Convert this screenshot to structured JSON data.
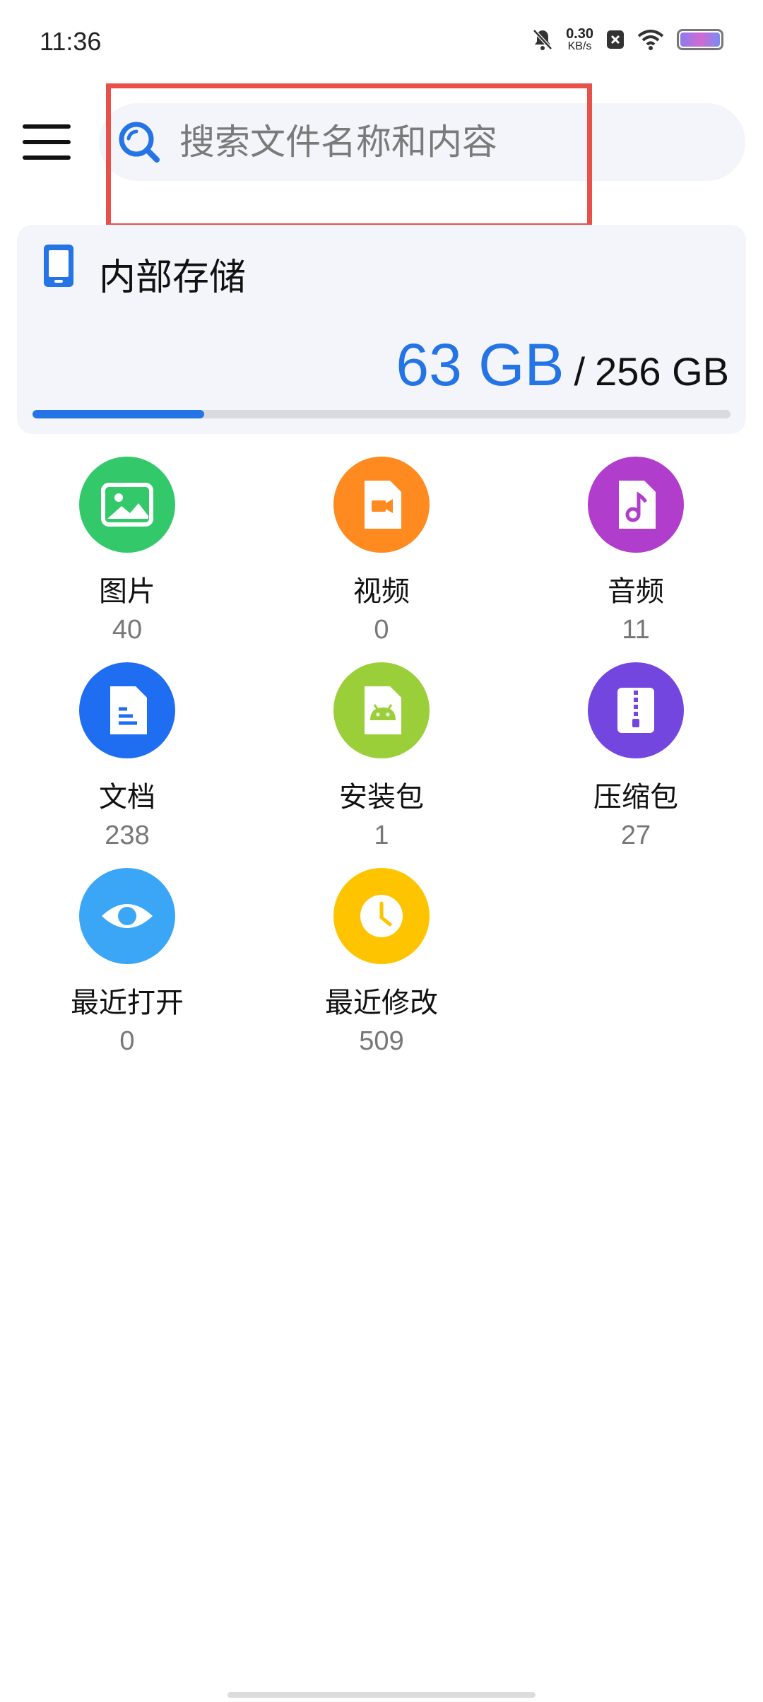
{
  "status_bar": {
    "time": "11:36",
    "net_speed_value": "0.30",
    "net_speed_unit": "KB/s",
    "icons": [
      "bell-muted-icon",
      "close-badge-icon",
      "wifi-icon",
      "battery-icon"
    ]
  },
  "header": {
    "menu_icon": "hamburger-menu-icon",
    "search_placeholder": "搜索文件名称和内容",
    "search_icon": "search-icon"
  },
  "storage": {
    "title": "内部存储",
    "used": "63 GB",
    "separator": "/",
    "total": "256 GB",
    "used_fraction": 0.246,
    "accent": "#2474e5"
  },
  "categories": [
    {
      "name": "图片",
      "count": "40",
      "icon": "image-icon",
      "color": "#33c96b"
    },
    {
      "name": "视频",
      "count": "0",
      "icon": "video-icon",
      "color": "#ff8a1f"
    },
    {
      "name": "音频",
      "count": "11",
      "icon": "music-icon",
      "color": "#b03dcc"
    },
    {
      "name": "文档",
      "count": "238",
      "icon": "document-icon",
      "color": "#1f6ef2"
    },
    {
      "name": "安装包",
      "count": "1",
      "icon": "android-icon",
      "color": "#9bcf3a"
    },
    {
      "name": "压缩包",
      "count": "27",
      "icon": "zip-icon",
      "color": "#7446e0"
    },
    {
      "name": "最近打开",
      "count": "0",
      "icon": "eye-icon",
      "color": "#3aa6f5"
    },
    {
      "name": "最近修改",
      "count": "509",
      "icon": "clock-icon",
      "color": "#ffc400"
    }
  ]
}
